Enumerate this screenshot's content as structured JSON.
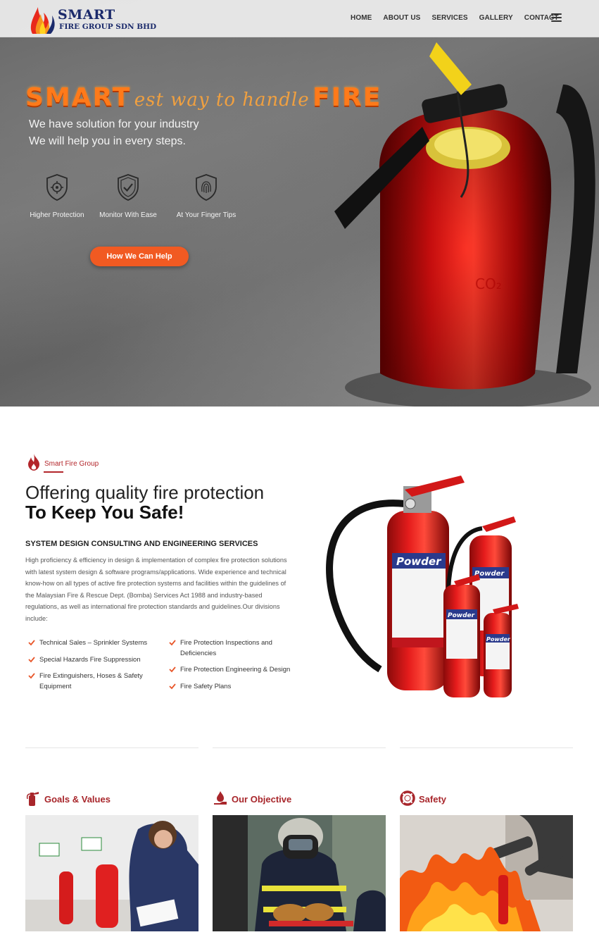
{
  "brand": {
    "name": "SMART",
    "subtitle": "FIRE GROUP SDN BHD"
  },
  "nav": {
    "items": [
      "HOME",
      "ABOUT US",
      "SERVICES",
      "GALLERY",
      "CONTACT"
    ],
    "menu_icon": "hamburger-icon"
  },
  "hero": {
    "headline_fire1": "SMART",
    "headline_script": "est way to handle",
    "headline_fire2": "FIRE",
    "line1": "We have solution for your industry",
    "line2": "We will help you in every steps.",
    "features": [
      {
        "icon": "shield-gear-icon",
        "label": "Higher Protection"
      },
      {
        "icon": "shield-check-icon",
        "label": "Monitor With Ease"
      },
      {
        "icon": "shield-fingerprint-icon",
        "label": "At Your Finger Tips"
      }
    ],
    "cta_label": "How We Can Help"
  },
  "about": {
    "kicker": "Smart Fire Group",
    "heading_line1": "Offering quality fire protection",
    "heading_line2": "To Keep You Safe!",
    "subheading": "SYSTEM DESIGN CONSULTING AND ENGINEERING SERVICES",
    "paragraph": "High proficiency & efficiency in design & implementation of complex fire protection solutions with latest system design & software programs/applications. Wide experience and technical know-how on all types of active fire protection systems and facilities within the guidelines of the Malaysian Fire & Rescue Dept. (Bomba) Services Act 1988 and industry-based regulations, as well as international fire protection standards and guidelines.Our divisions include:",
    "list_left": [
      "Technical Sales – Sprinkler Systems",
      "Special Hazards Fire Suppression",
      "Fire Extinguishers, Hoses & Safety Equipment"
    ],
    "list_right": [
      "Fire Protection Inspections and Deficiencies",
      "Fire Protection Engineering & Design",
      "Fire Safety Plans"
    ]
  },
  "cards": [
    {
      "icon": "extinguisher-icon",
      "title": "Goals & Values"
    },
    {
      "icon": "flame-hand-icon",
      "title": "Our Objective"
    },
    {
      "icon": "lifebuoy-icon",
      "title": "Safety"
    }
  ],
  "colors": {
    "accent_orange": "#f15a22",
    "brand_red": "#b3262b",
    "brand_navy": "#1b2a6b"
  }
}
